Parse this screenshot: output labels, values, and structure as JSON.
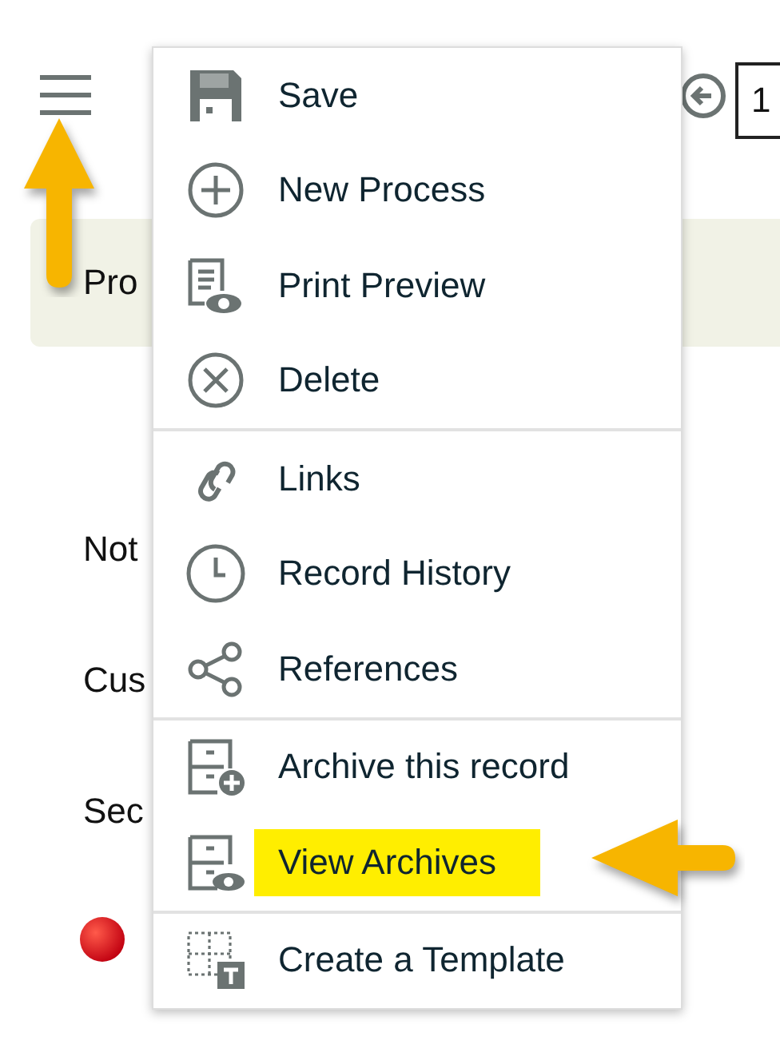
{
  "header": {
    "field_value": "1"
  },
  "banner": {
    "text": "Pro"
  },
  "fields": [
    {
      "label": "Not"
    },
    {
      "label": "Cus"
    },
    {
      "label": "Sec"
    }
  ],
  "menu": {
    "groups": [
      {
        "items": [
          {
            "label": "Save",
            "highlighted": false
          },
          {
            "label": "New Process",
            "highlighted": false
          },
          {
            "label": "Print Preview",
            "highlighted": false
          },
          {
            "label": "Delete",
            "highlighted": false
          }
        ]
      },
      {
        "items": [
          {
            "label": "Links",
            "highlighted": false
          },
          {
            "label": "Record History",
            "highlighted": false
          },
          {
            "label": "References",
            "highlighted": false
          }
        ]
      },
      {
        "items": [
          {
            "label": "Archive this record",
            "highlighted": false
          },
          {
            "label": "View Archives",
            "highlighted": true
          }
        ]
      },
      {
        "items": [
          {
            "label": "Create a Template",
            "highlighted": false
          }
        ]
      }
    ]
  }
}
